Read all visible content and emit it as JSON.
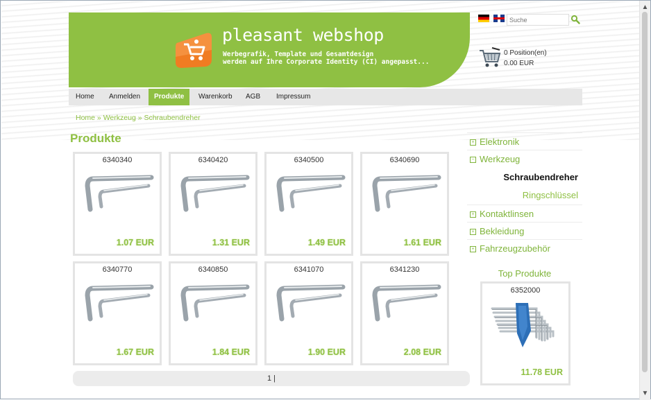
{
  "header": {
    "shop_name": "pleasant webshop",
    "tagline_line1": "Werbegrafik, Template und Gesamtdesign",
    "tagline_line2": "werden auf Ihre Corporate Identity (CI) angepasst..."
  },
  "search": {
    "placeholder": "Suche"
  },
  "cart": {
    "positions": "0 Position(en)",
    "total": "0.00 EUR"
  },
  "nav": {
    "items": [
      {
        "label": "Home"
      },
      {
        "label": "Anmelden"
      },
      {
        "label": "Produkte"
      },
      {
        "label": "Warenkorb"
      },
      {
        "label": "AGB"
      },
      {
        "label": "Impressum"
      }
    ],
    "active": "Produkte"
  },
  "breadcrumb": {
    "home": "Home",
    "sep1": " » ",
    "level1": "Werkzeug",
    "sep2": " » ",
    "level2": "Schraubendreher"
  },
  "main": {
    "title": "Produkte"
  },
  "products": [
    {
      "sku": "6340340",
      "price": "1.07 EUR"
    },
    {
      "sku": "6340420",
      "price": "1.31 EUR"
    },
    {
      "sku": "6340500",
      "price": "1.49 EUR"
    },
    {
      "sku": "6340690",
      "price": "1.61 EUR"
    },
    {
      "sku": "6340770",
      "price": "1.67 EUR"
    },
    {
      "sku": "6340850",
      "price": "1.84 EUR"
    },
    {
      "sku": "6341070",
      "price": "1.90 EUR"
    },
    {
      "sku": "6341230",
      "price": "2.08 EUR"
    }
  ],
  "pager": {
    "text": "1 |"
  },
  "sidebar": {
    "categories": [
      {
        "label": "Elektronik",
        "expanded": false
      },
      {
        "label": "Werkzeug",
        "expanded": true
      },
      {
        "label": "Kontaktlinsen",
        "expanded": false
      },
      {
        "label": "Bekleidung",
        "expanded": false
      },
      {
        "label": "Fahrzeugzubehör",
        "expanded": false
      }
    ],
    "subcategories": [
      {
        "label": "Schraubendreher",
        "active": true
      },
      {
        "label": "Ringschlüssel",
        "active": false
      }
    ],
    "top_title": "Top Produkte",
    "top_product": {
      "sku": "6352000",
      "price": "11.78 EUR"
    }
  },
  "colors": {
    "brand_green": "#8fc043",
    "nav_bg": "#e7e7e7"
  }
}
